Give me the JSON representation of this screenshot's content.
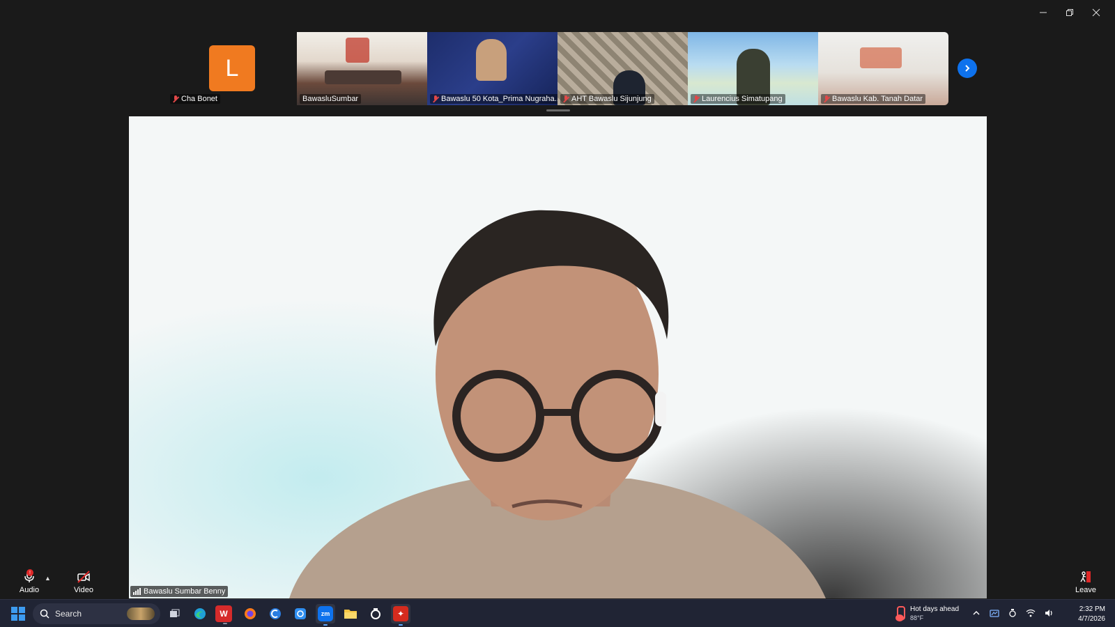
{
  "window": {
    "controls": {
      "minimize": "minimize-icon",
      "restore": "restore-icon",
      "close": "close-icon"
    }
  },
  "self_tile": {
    "initial": "L",
    "name": "Cha Bonet",
    "avatar_color": "#f07a20"
  },
  "participants": [
    {
      "name": "BawasluSumbar"
    },
    {
      "name": "Bawaslu 50 Kota_Prima Nugraha..."
    },
    {
      "name": "AHT Bawaslu Sijunjung"
    },
    {
      "name": "Laurencius Simatupang"
    },
    {
      "name": "Bawaslu Kab. Tanah Datar"
    }
  ],
  "main_video": {
    "speaker_name": "Bawaslu Sumbar Benny"
  },
  "controls": {
    "audio_label": "Audio",
    "audio_badge": "!",
    "video_label": "Video",
    "leave_label": "Leave"
  },
  "taskbar": {
    "search_placeholder": "Search",
    "weather_title": "Hot days ahead",
    "weather_temp": "88°F",
    "time": "2:32 PM",
    "date": "4/7/2026"
  },
  "colors": {
    "accent_blue": "#0e72ed",
    "leave_red": "#e02828",
    "mute_red": "#e04848",
    "taskbar_bg": "#202434"
  }
}
